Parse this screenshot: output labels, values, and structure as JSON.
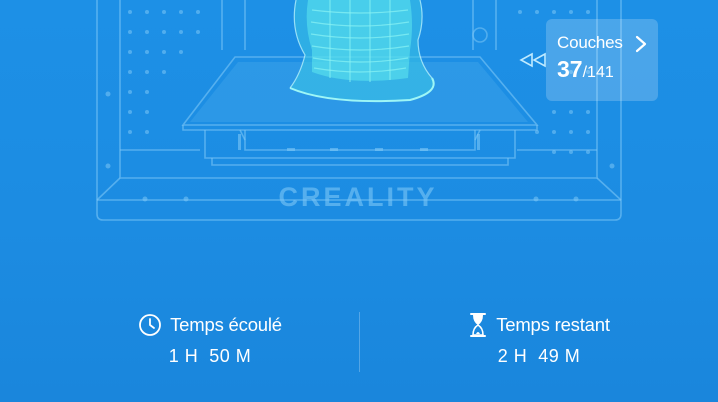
{
  "layers": {
    "label": "Couches",
    "current": "37",
    "total": "/141"
  },
  "brand": "CREALITY",
  "stats": {
    "elapsed": {
      "label": "Temps écoulé",
      "value": "1 H  50 M"
    },
    "remaining": {
      "label": "Temps restant",
      "value": "2 H  49 M"
    }
  },
  "colors": {
    "background": "#1d90e6",
    "outline": "#7cc6f6",
    "model": "#5fe8ee",
    "panel": "#ffffff"
  },
  "icons": {
    "layers_chevron": "chevron-right-icon",
    "layer_pointer": "double-triangle-left-icon",
    "elapsed": "clock-icon",
    "remaining": "hourglass-icon"
  }
}
